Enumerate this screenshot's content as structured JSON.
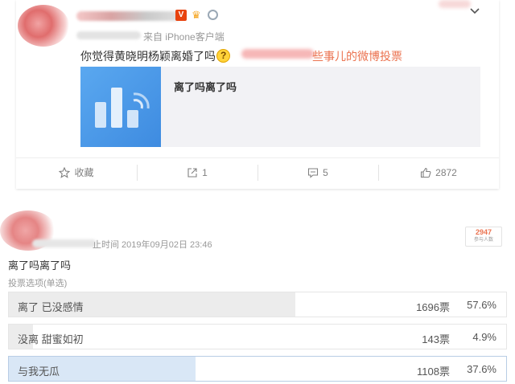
{
  "post": {
    "meta_source": "来自 iPhone客户端",
    "text": "你觉得黄晓明杨颖离婚了吗",
    "link_text": "些事儿的微博投票",
    "poll_card_title": "离了吗离了吗",
    "actions": [
      {
        "icon": "star-icon",
        "label": "收藏"
      },
      {
        "icon": "repost-icon",
        "label": "1"
      },
      {
        "icon": "comment-icon",
        "label": "5"
      },
      {
        "icon": "like-icon",
        "label": "2872"
      }
    ]
  },
  "vote": {
    "meta": "止时间 2019年09月02日 23:46",
    "participants_count": "2947",
    "participants_label": "参与人数",
    "title": "离了吗离了吗",
    "type_label": "投票选项(单选)",
    "options": [
      {
        "label": "离了 已没感情",
        "votes": "1696票",
        "percent": "57.6%",
        "fill_fraction": 0.576,
        "selected": false
      },
      {
        "label": "没离 甜蜜如初",
        "votes": "143票",
        "percent": "4.9%",
        "fill_fraction": 0.049,
        "selected": false
      },
      {
        "label": "与我无瓜",
        "votes": "1108票",
        "percent": "37.6%",
        "fill_fraction": 0.376,
        "selected": true
      }
    ]
  },
  "colors": {
    "accent_link": "#eb7350",
    "poll_thumb": "#4a98e8",
    "selected_fill": "#d9e7f6",
    "bar_fill": "#ececec"
  }
}
